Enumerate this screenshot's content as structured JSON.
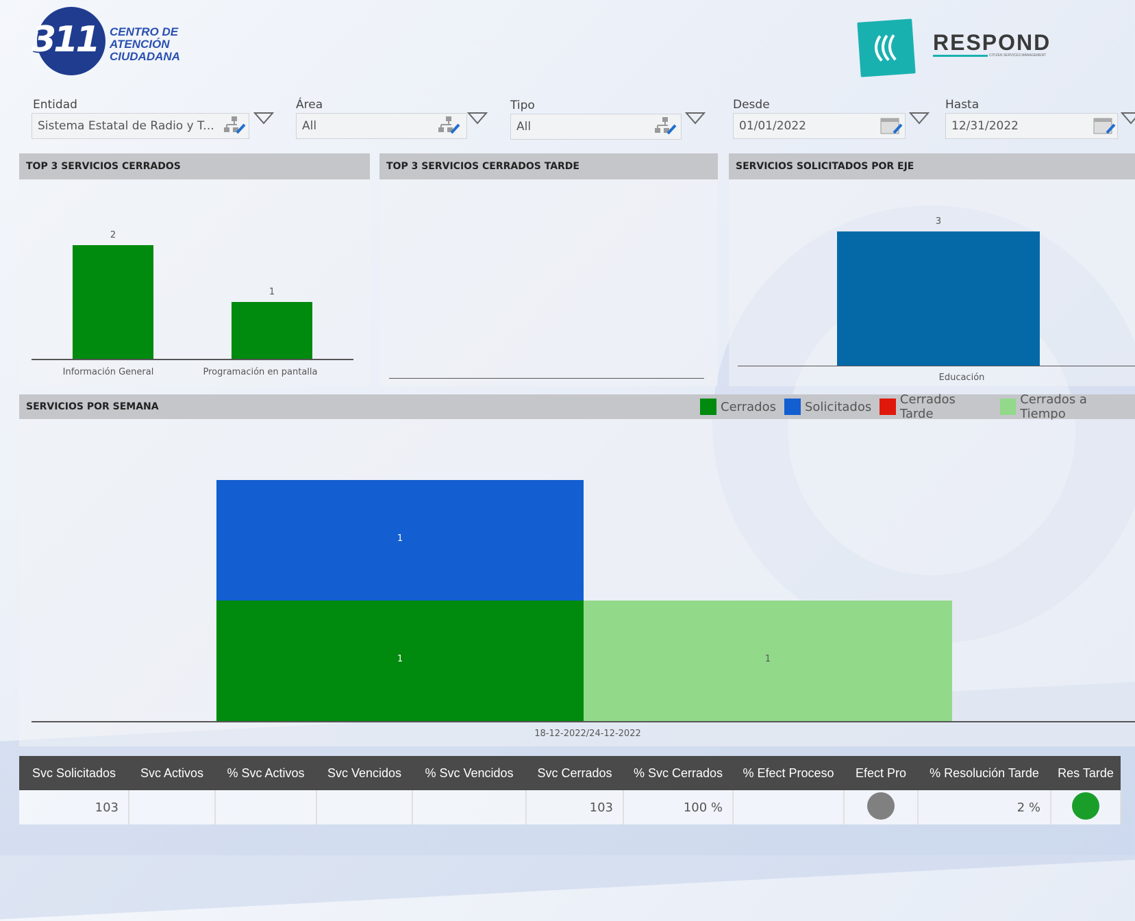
{
  "header": {
    "logo_number": "311",
    "logo_lines": [
      "CENTRO DE",
      "ATENCIÓN",
      "CIUDADANA"
    ],
    "brand": "RESPOND",
    "brand_sub": "CITIZEN SERVICES MANAGEMENT"
  },
  "filters": {
    "entidad": {
      "label": "Entidad",
      "value": "Sistema Estatal de Radio y T..."
    },
    "area": {
      "label": "Área",
      "value": "All"
    },
    "tipo": {
      "label": "Tipo",
      "value": "All"
    },
    "desde": {
      "label": "Desde",
      "value": "01/01/2022"
    },
    "hasta": {
      "label": "Hasta",
      "value": "12/31/2022"
    }
  },
  "panels": {
    "top3_cerrados": "TOP 3 SERVICIOS CERRADOS",
    "top3_tarde": "TOP 3 SERVICIOS CERRADOS TARDE",
    "por_eje": "SERVICIOS SOLICITADOS POR EJE",
    "por_semana": "SERVICIOS POR SEMANA"
  },
  "chart_data": [
    {
      "type": "bar",
      "title": "TOP 3 SERVICIOS CERRADOS",
      "categories": [
        "Información General",
        "Programación en pantalla"
      ],
      "values": [
        2,
        1
      ],
      "color": "#008a0e"
    },
    {
      "type": "bar",
      "title": "TOP 3 SERVICIOS CERRADOS TARDE",
      "categories": [],
      "values": []
    },
    {
      "type": "bar",
      "title": "SERVICIOS SOLICITADOS POR EJE",
      "categories": [
        "Educación"
      ],
      "values": [
        3
      ],
      "color": "#0569a8"
    },
    {
      "type": "bar",
      "title": "SERVICIOS POR SEMANA",
      "categories": [
        "18-12-2022/24-12-2022"
      ],
      "legend": [
        "Cerrados",
        "Solicitados",
        "Cerrados Tarde",
        "Cerrados a Tiempo"
      ],
      "legend_colors": [
        "#008a0e",
        "#135ed0",
        "#e0180c",
        "#92d98a"
      ],
      "series": [
        {
          "name": "Cerrados",
          "values": [
            1
          ]
        },
        {
          "name": "Solicitados",
          "values": [
            1
          ]
        },
        {
          "name": "Cerrados Tarde",
          "values": [
            0
          ]
        },
        {
          "name": "Cerrados a Tiempo",
          "values": [
            1
          ]
        }
      ]
    }
  ],
  "table": {
    "headers": [
      "Svc Solicitados",
      "Svc Activos",
      "% Svc Activos",
      "Svc Vencidos",
      "% Svc Vencidos",
      "Svc Cerrados",
      "% Svc Cerrados",
      "% Efect Proceso",
      "Efect Pro",
      "% Resolución Tarde",
      "Res Tarde"
    ],
    "row": [
      "103",
      "",
      "",
      "",
      "",
      "103",
      "100 %",
      "",
      "",
      "2 %",
      ""
    ],
    "efect_pro_color": "#808080",
    "res_tarde_color": "#1a9e2a"
  }
}
